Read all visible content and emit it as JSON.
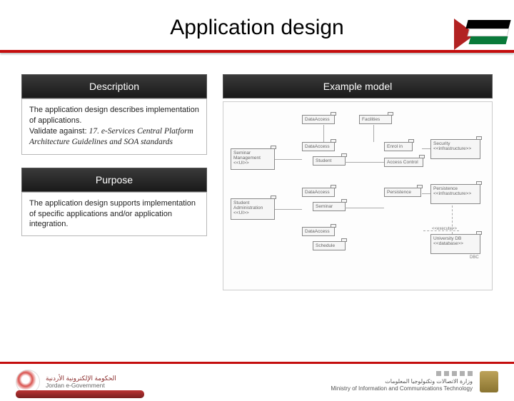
{
  "title": "Application design",
  "sections": {
    "description": {
      "header": "Description",
      "body_line1": "The application design describes implementation of applications.",
      "body_line2_prefix": "Validate against: ",
      "body_line2_italic": "17. e-Services Central Platform Architecture Guidelines and SOA standards"
    },
    "purpose": {
      "header": "Purpose",
      "body": "The application design supports implementation of specific applications and/or application integration."
    },
    "example_model": {
      "header": "Example model"
    }
  },
  "diagram_boxes": {
    "data_access_top": "DataAccess",
    "facilities_top": "Facilities",
    "seminar_mgmt": "Seminar Management <<UI>>",
    "data_access_mid": "DataAccess",
    "student": "Student",
    "enrolin": "Enrol in",
    "security": "Security <<infrastructure>>",
    "access_control": "Access Control",
    "student_admin": "Student Administration <<UI>>",
    "data_access_lower": "DataAccess",
    "seminar": "Seminar",
    "persistence_top": "Persistence",
    "persistence": "Persistence <<infrastructure>>",
    "data_access_bottom": "DataAccess",
    "schedule": "Schedule",
    "univ_db": "University DB <<database>>",
    "execute": "<<execute>>",
    "dbc": "DBC"
  },
  "footer": {
    "left_arabic": "الحكومة الإلكترونية الأردنية",
    "left_en": "Jordan e-Government",
    "right_arabic": "وزارة الاتصالات وتكنولوجيا المعلومات",
    "right_en": "Ministry of Information and Communications Technology"
  }
}
